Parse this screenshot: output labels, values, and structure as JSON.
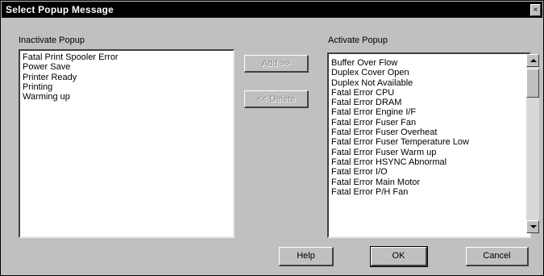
{
  "window": {
    "title": "Select Popup Message",
    "close_glyph": "×"
  },
  "inactivate": {
    "label": "Inactivate Popup",
    "items": [
      "Fatal Print Spooler Error",
      "Power Save",
      "Printer Ready",
      "Printing",
      "Warming up"
    ]
  },
  "activate": {
    "label": "Activate Popup",
    "items": [
      "Buffer Over Flow",
      "Duplex Cover Open",
      "Duplex Not Available",
      "Fatal Error CPU",
      "Fatal Error DRAM",
      "Fatal Error Engine I/F",
      "Fatal Error Fuser Fan",
      "Fatal Error Fuser Overheat",
      "Fatal Error Fuser Temperature Low",
      "Fatal Error Fuser Warm up",
      "Fatal Error HSYNC Abnormal",
      "Fatal Error I/O",
      "Fatal Error Main Motor",
      "Fatal Error P/H Fan"
    ]
  },
  "buttons": {
    "add": "Add >>",
    "delete": "<< Delete",
    "help": "Help",
    "ok": "OK",
    "cancel": "Cancel"
  }
}
